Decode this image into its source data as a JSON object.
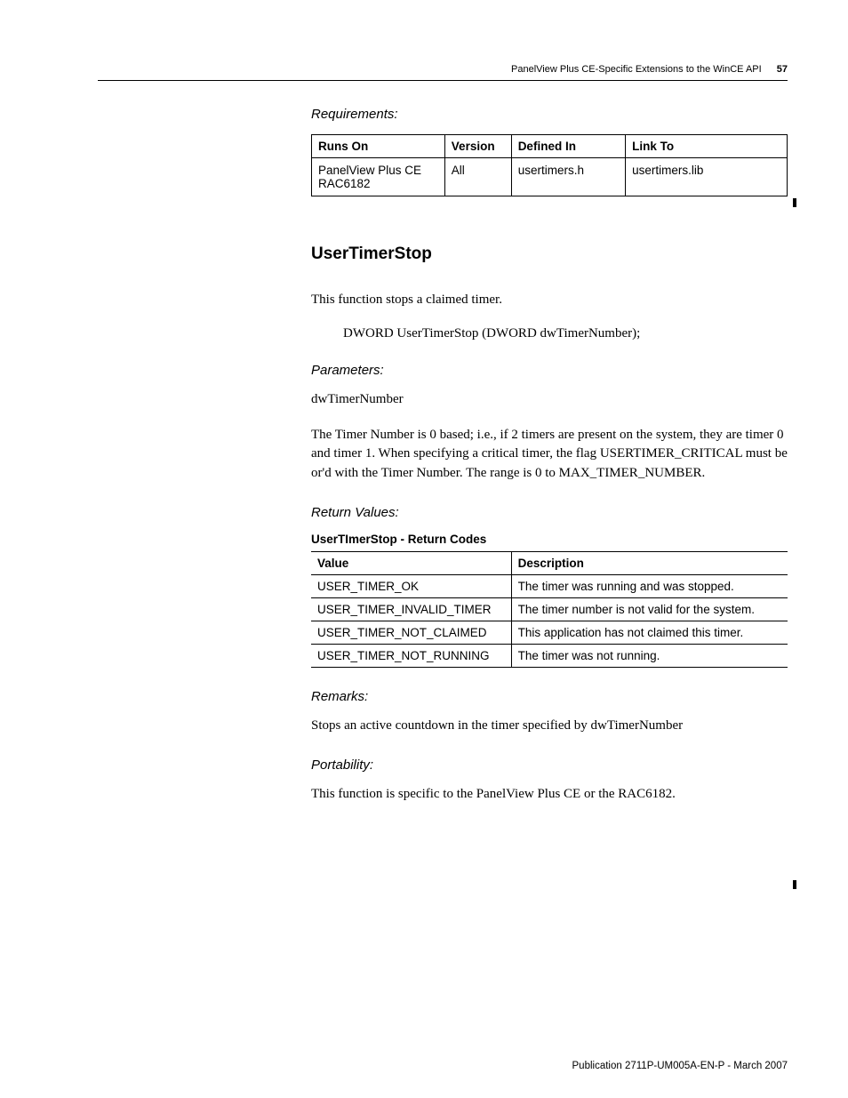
{
  "header": {
    "running_title": "PanelView Plus CE-Specific Extensions to the WinCE API",
    "page_number": "57"
  },
  "sec_requirements": {
    "heading": "Requirements:",
    "cols": {
      "c0": "Runs On",
      "c1": "Version",
      "c2": "Defined In",
      "c3": "Link To"
    },
    "row": {
      "c0": "PanelView Plus CE RAC6182",
      "c1": "All",
      "c2": "usertimers.h",
      "c3": "usertimers.lib"
    }
  },
  "sec_function": {
    "title": "UserTimerStop",
    "intro": "This function stops a claimed timer.",
    "signature": "DWORD UserTimerStop (DWORD dwTimerNumber);"
  },
  "sec_parameters": {
    "heading": "Parameters:",
    "name": "dwTimerNumber",
    "desc": "The Timer Number is 0 based; i.e., if 2 timers are present on the system, they are timer 0 and timer 1. When specifying a critical timer, the flag USERTIMER_CRITICAL must be or'd with the Timer Number. The range is 0 to MAX_TIMER_NUMBER."
  },
  "sec_return": {
    "heading": "Return Values:",
    "caption": "UserTImerStop - Return Codes",
    "cols": {
      "c0": "Value",
      "c1": "Description"
    },
    "rows": {
      "r0": {
        "c0": "USER_TIMER_OK",
        "c1": "The timer was running and was stopped."
      },
      "r1": {
        "c0": "USER_TIMER_INVALID_TIMER",
        "c1": "The timer number is not valid for the system."
      },
      "r2": {
        "c0": "USER_TIMER_NOT_CLAIMED",
        "c1": "This application has not claimed this timer."
      },
      "r3": {
        "c0": "USER_TIMER_NOT_RUNNING",
        "c1": "The timer was not running."
      }
    }
  },
  "sec_remarks": {
    "heading": "Remarks:",
    "text": "Stops an active countdown in the timer specified by dwTimerNumber"
  },
  "sec_portability": {
    "heading": "Portability:",
    "text": "This function is specific to the PanelView Plus CE or the RAC6182."
  },
  "footer": {
    "text": "Publication 2711P-UM005A-EN-P - March 2007"
  }
}
